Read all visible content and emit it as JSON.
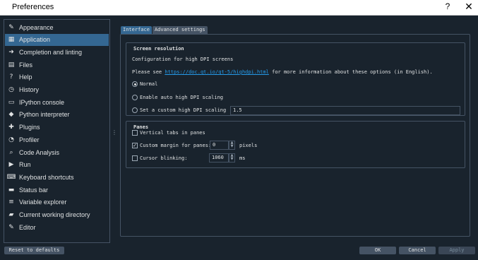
{
  "window": {
    "title": "Preferences",
    "help_glyph": "?",
    "close_glyph": "✕"
  },
  "sidebar": {
    "items": [
      {
        "label": "Appearance",
        "icon": "brush-icon",
        "glyph": "✎",
        "selected": false
      },
      {
        "label": "Application",
        "icon": "application-window-icon",
        "glyph": "▦",
        "selected": true
      },
      {
        "label": "Completion and linting",
        "icon": "completion-arrow-icon",
        "glyph": "➜",
        "selected": false
      },
      {
        "label": "Files",
        "icon": "files-icon",
        "glyph": "▤",
        "selected": false
      },
      {
        "label": "Help",
        "icon": "help-circle-icon",
        "glyph": "?",
        "selected": false
      },
      {
        "label": "History",
        "icon": "history-icon",
        "glyph": "◷",
        "selected": false
      },
      {
        "label": "IPython console",
        "icon": "console-icon",
        "glyph": "▭",
        "selected": false
      },
      {
        "label": "Python interpreter",
        "icon": "python-logo-icon",
        "glyph": "◆",
        "selected": false
      },
      {
        "label": "Plugins",
        "icon": "puzzle-icon",
        "glyph": "✚",
        "selected": false
      },
      {
        "label": "Profiler",
        "icon": "profiler-clock-icon",
        "glyph": "◔",
        "selected": false
      },
      {
        "label": "Code Analysis",
        "icon": "code-analysis-icon",
        "glyph": "⌕",
        "selected": false
      },
      {
        "label": "Run",
        "icon": "run-play-icon",
        "glyph": "▶",
        "selected": false
      },
      {
        "label": "Keyboard shortcuts",
        "icon": "keyboard-icon",
        "glyph": "⌨",
        "selected": false
      },
      {
        "label": "Status bar",
        "icon": "status-bar-icon",
        "glyph": "▬",
        "selected": false
      },
      {
        "label": "Variable explorer",
        "icon": "variable-list-icon",
        "glyph": "≡",
        "selected": false
      },
      {
        "label": "Current working directory",
        "icon": "folder-icon",
        "glyph": "▰",
        "selected": false
      },
      {
        "label": "Editor",
        "icon": "pencil-icon",
        "glyph": "✎",
        "selected": false
      }
    ]
  },
  "splitter_glyph": "⋮",
  "tabs": [
    {
      "label": "Interface",
      "active": true
    },
    {
      "label": "Advanced settings",
      "active": false
    }
  ],
  "screen_resolution": {
    "title": "Screen resolution",
    "description": "Configuration for high DPI screens",
    "see_prefix": "Please see",
    "link": "https://doc.qt.io/qt-5/highdpi.html",
    "see_suffix": "for more information about these options (in English).",
    "options": [
      {
        "label": "Normal",
        "checked": true
      },
      {
        "label": "Enable auto high DPI scaling",
        "checked": false
      },
      {
        "label": "Set a custom high DPI scaling",
        "checked": false
      }
    ],
    "custom_scaling_value": "1.5"
  },
  "panes": {
    "title": "Panes",
    "vertical_tabs": {
      "label": "Vertical tabs in panes",
      "checked": false
    },
    "custom_margin": {
      "label": "Custom margin for panes:",
      "checked": true,
      "value": "0",
      "unit": "pixels"
    },
    "cursor_blinking": {
      "label": "Cursor blinking:",
      "checked": false,
      "value": "1060",
      "unit": "ms"
    }
  },
  "spin_up_glyph": "▲",
  "spin_down_glyph": "▼",
  "check_glyph": "✓",
  "buttons": {
    "reset": "Reset to defaults",
    "ok": "OK",
    "cancel": "Cancel",
    "apply": "Apply"
  }
}
